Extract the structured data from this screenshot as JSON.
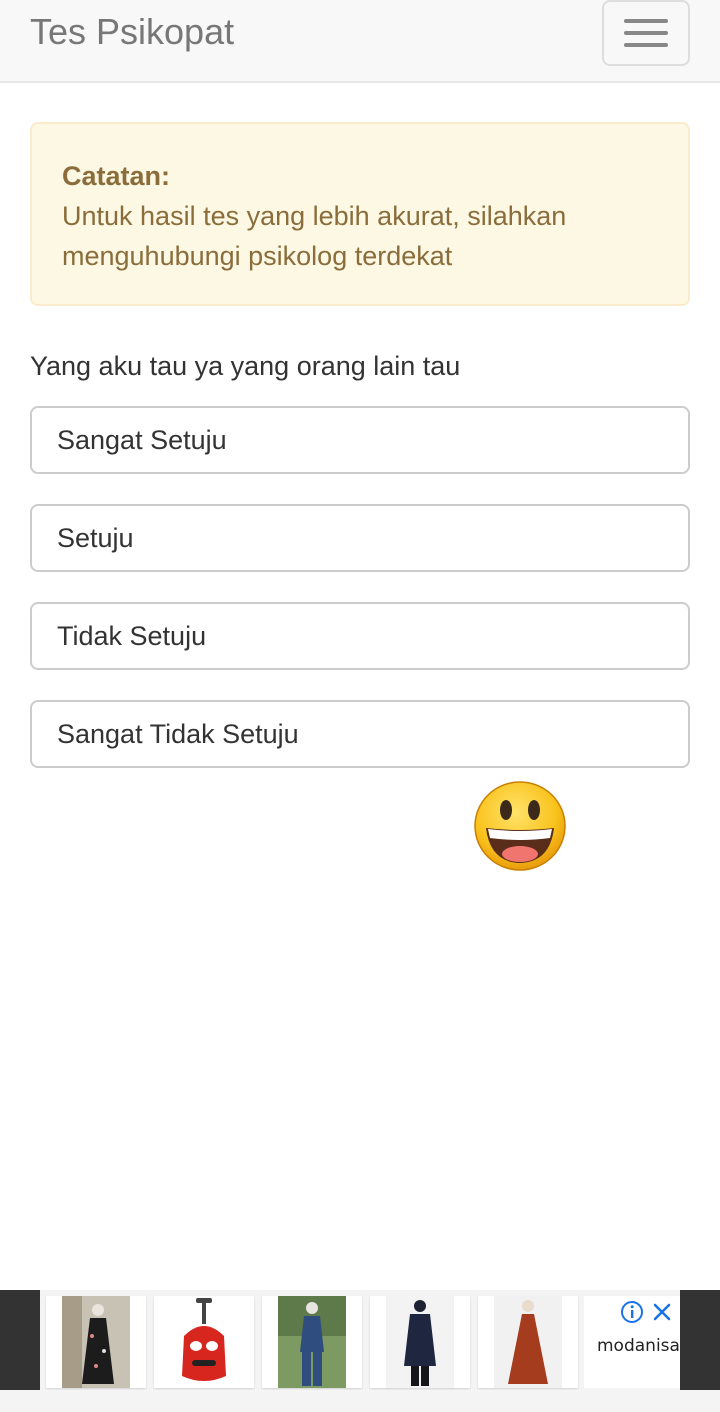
{
  "navbar": {
    "brand": "Tes Psikopat",
    "menu_icon": "hamburger-menu-icon"
  },
  "alert": {
    "title": "Catatan:",
    "message": "Untuk hasil tes yang lebih akurat, silahkan menguhubungi psikolog terdekat"
  },
  "question": {
    "text": "Yang aku tau ya yang orang lain tau",
    "options": [
      "Sangat Setuju",
      "Setuju",
      "Tidak Setuju",
      "Sangat Tidak Setuju"
    ]
  },
  "decoration": {
    "icon": "grinning-face-emoji-icon"
  },
  "ad": {
    "brand": "modanisa",
    "items": [
      "floral-black-dress",
      "red-car-kids-backpack",
      "blue-denim-suit",
      "navy-tunic",
      "rust-maxi-dress"
    ],
    "info_icon": "ad-info-icon",
    "close_icon": "ad-close-icon"
  },
  "colors": {
    "navbar_bg": "#f8f8f8",
    "brand_text": "#777777",
    "alert_bg": "#fcf8e3",
    "alert_border": "#faebcc",
    "alert_text": "#8a6d3b",
    "option_border": "#cccccc",
    "ad_accent": "#1a73e8"
  }
}
